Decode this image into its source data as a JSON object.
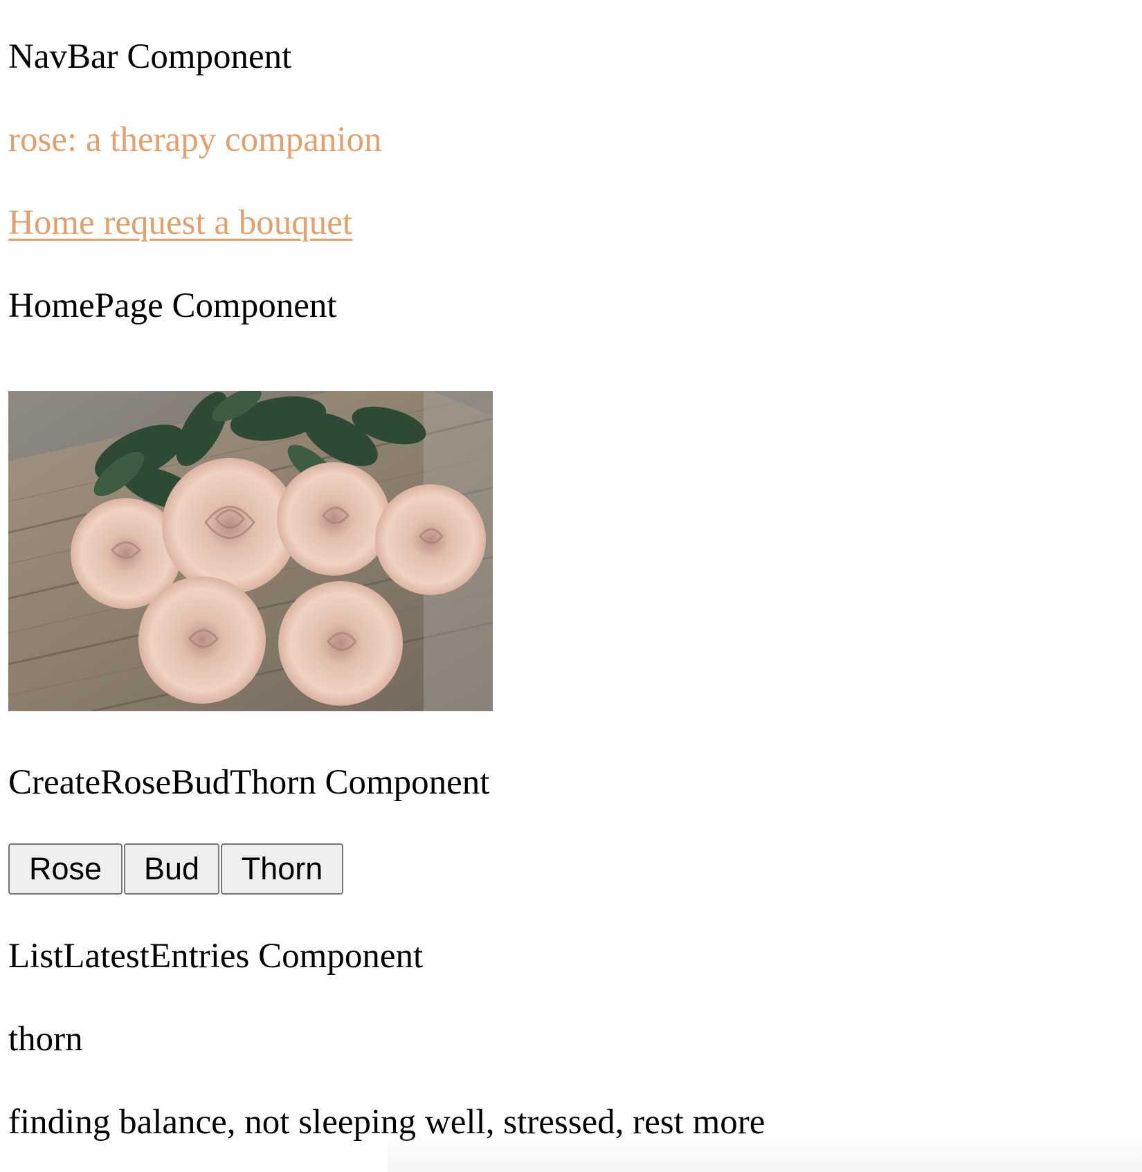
{
  "navbar": {
    "component_label": "NavBar Component",
    "brand": "rose: a therapy companion",
    "links": [
      "Home",
      "request a bouquet"
    ]
  },
  "homepage": {
    "component_label": "HomePage Component",
    "hero_image": "bouquet of dusty pink roses on a rustic wooden table"
  },
  "create_rose_bud_thorn": {
    "component_label": "CreateRoseBudThorn Component",
    "buttons": [
      "Rose",
      "Bud",
      "Thorn"
    ]
  },
  "list_latest_entries": {
    "component_label": "ListLatestEntries Component",
    "entries": [
      {
        "type": "thorn",
        "text": "finding balance, not sleeping well, stressed, rest more"
      }
    ]
  },
  "colors": {
    "accent": "#e3a06d",
    "text": "#000000",
    "button_bg": "#efefef",
    "button_border": "#767676"
  }
}
